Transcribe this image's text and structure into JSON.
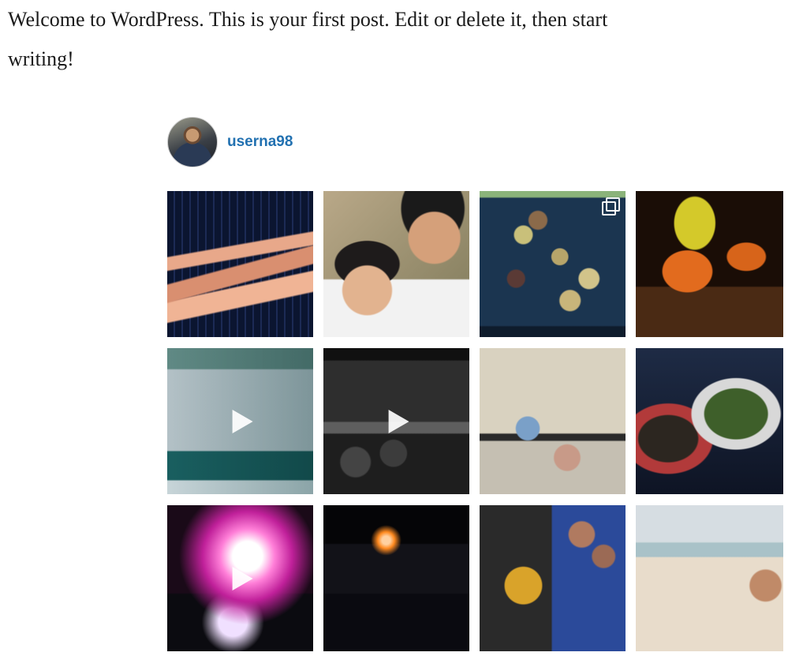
{
  "post": {
    "text": "Welcome to WordPress. This is your first post. Edit or delete it, then start writing!"
  },
  "feed": {
    "profile": {
      "username": "userna98"
    },
    "items": [
      {
        "kind": "photo"
      },
      {
        "kind": "photo"
      },
      {
        "kind": "carousel",
        "badge_icon": "carousel-icon"
      },
      {
        "kind": "photo"
      },
      {
        "kind": "video",
        "badge_icon": "play-icon"
      },
      {
        "kind": "video",
        "badge_icon": "play-icon"
      },
      {
        "kind": "photo"
      },
      {
        "kind": "photo"
      },
      {
        "kind": "video",
        "badge_icon": "play-icon"
      },
      {
        "kind": "photo"
      },
      {
        "kind": "photo"
      },
      {
        "kind": "photo"
      }
    ],
    "colors": {
      "username": "#2271b1",
      "text": "#1a1a1a",
      "background": "#ffffff"
    }
  }
}
